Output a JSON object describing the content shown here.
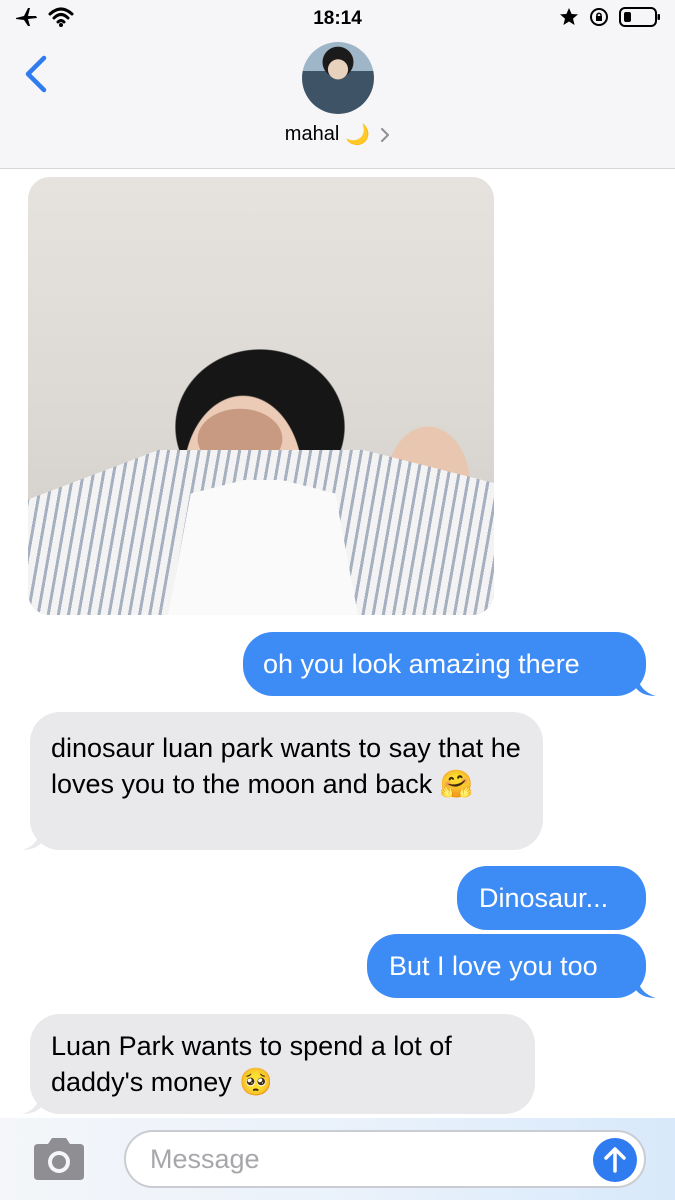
{
  "status_bar": {
    "time": "18:14",
    "icons": [
      "airplane-icon",
      "wifi-icon",
      "star-icon",
      "orientation-lock-icon",
      "battery-icon"
    ]
  },
  "header": {
    "contact_name": "mahal",
    "contact_emoji": "🌙",
    "icons": [
      "back-chevron-icon",
      "chevron-right-icon"
    ]
  },
  "messages": [
    {
      "type": "image",
      "direction": "received"
    },
    {
      "type": "text",
      "direction": "sent",
      "text": "oh you look amazing there"
    },
    {
      "type": "text",
      "direction": "received",
      "text": "dinosaur luan park wants to say that he loves you to the moon and back 🤗"
    },
    {
      "type": "text",
      "direction": "sent",
      "text": "Dinosaur..."
    },
    {
      "type": "text",
      "direction": "sent",
      "text": "But I love you too"
    },
    {
      "type": "text",
      "direction": "received",
      "text": "Luan Park wants to spend a lot of daddy's money 🥺"
    }
  ],
  "composer": {
    "placeholder": "Message",
    "icons": [
      "camera-icon",
      "send-arrow-icon"
    ]
  },
  "colors": {
    "sent_bubble": "#3d8bf5",
    "received_bubble": "#e9e9eb",
    "accent": "#2f7cf0"
  }
}
